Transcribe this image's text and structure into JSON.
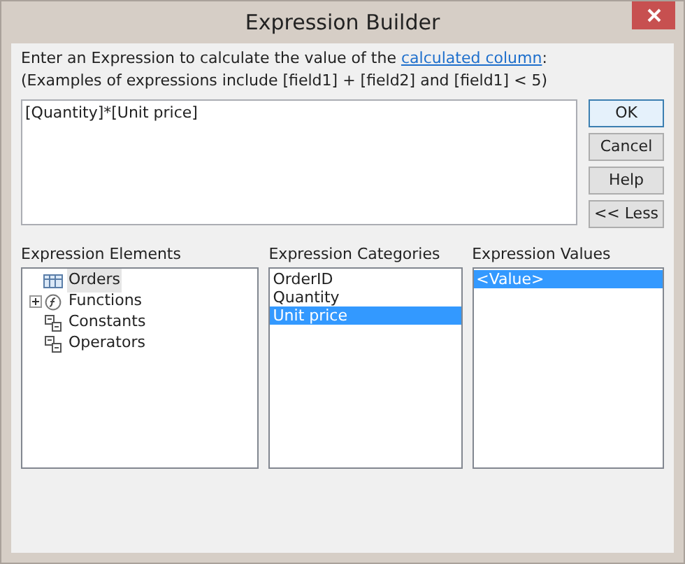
{
  "window": {
    "title": "Expression Builder"
  },
  "instructions": {
    "before_link": "Enter an Expression to calculate the value of the ",
    "link": "calculated column",
    "after_link": ":",
    "examples": "(Examples of expressions include [field1] + [field2] and [field1] < 5)"
  },
  "expression": {
    "value": "[Quantity]*[Unit price]"
  },
  "buttons": [
    {
      "label": "OK",
      "default": true
    },
    {
      "label": "Cancel",
      "default": false
    },
    {
      "label": "Help",
      "default": false
    },
    {
      "label": "<< Less",
      "default": false
    }
  ],
  "elements": {
    "title": "Expression Elements",
    "items": [
      {
        "label": "Orders",
        "kind": "table",
        "selected": true,
        "expandable": false
      },
      {
        "label": "Functions",
        "kind": "functions",
        "selected": false,
        "expandable": true
      },
      {
        "label": "Constants",
        "kind": "folder",
        "selected": false,
        "expandable": false
      },
      {
        "label": "Operators",
        "kind": "folder",
        "selected": false,
        "expandable": false
      }
    ]
  },
  "categories": {
    "title": "Expression Categories",
    "items": [
      {
        "label": "OrderID",
        "selected": false
      },
      {
        "label": "Quantity",
        "selected": false
      },
      {
        "label": "Unit price",
        "selected": true
      }
    ]
  },
  "values": {
    "title": "Expression Values",
    "items": [
      {
        "label": "<Value>",
        "selected": true
      }
    ]
  }
}
